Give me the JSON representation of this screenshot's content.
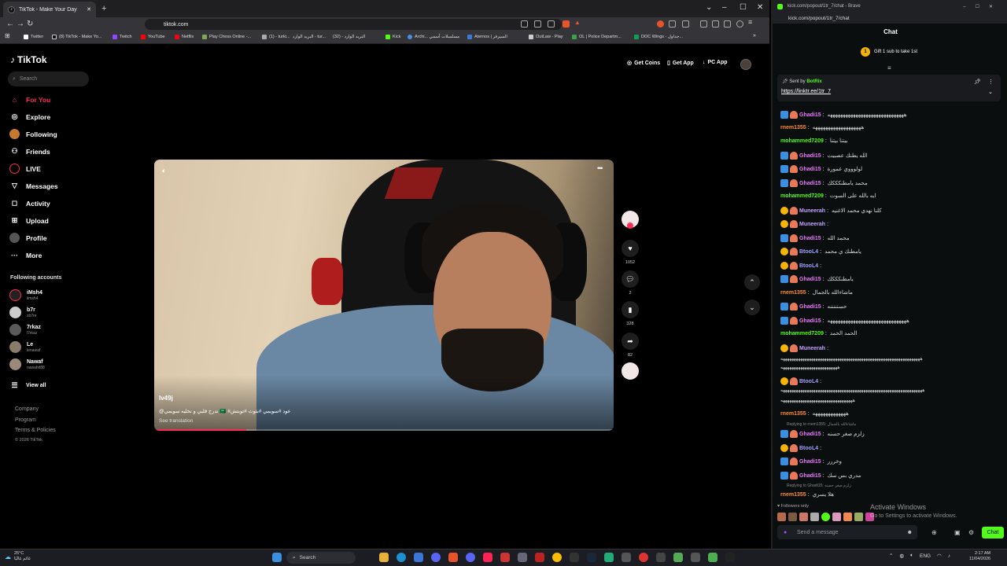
{
  "left_browser": {
    "tab_title": "TikTok - Make Your Day",
    "url": "tiktok.com",
    "bookmarks": [
      "Twitter",
      "(8) TikTok - Make Yo...",
      "Twitch",
      "YouTube",
      "Netflix",
      "Play Chess Online -...",
      "(1) - turki...",
      "البريد الوارد - tur...",
      "(32) - البريد الوارد",
      "Kick",
      "Archi... مسلسلات أسمي",
      "Aternos | السيرفر",
      "OutLaw - Play",
      "OL | Police Departm...",
      "DOC Wings - جداول..."
    ]
  },
  "tiktok": {
    "logo": "TikTok",
    "search_placeholder": "Search",
    "nav": [
      "For You",
      "Explore",
      "Following",
      "Friends",
      "LIVE",
      "Messages",
      "Activity",
      "Upload",
      "Profile",
      "More"
    ],
    "following_title": "Following accounts",
    "accounts": [
      {
        "name": "iMsh4",
        "handle": "iimsh4"
      },
      {
        "name": "b7r",
        "handle": "xb7re"
      },
      {
        "name": "7rkaz",
        "handle": "l7rkaz"
      },
      {
        "name": "Le",
        "handle": "lenawaf"
      },
      {
        "name": "Nawaf",
        "handle": "nawafxt88"
      }
    ],
    "view_all": "View all",
    "footer": [
      "Company",
      "Program",
      "Terms & Policies"
    ],
    "copyright": "© 2026 TikTok",
    "top_buttons": [
      "Get Coins",
      "Get App",
      "PC App"
    ],
    "video": {
      "author": "lv49j",
      "caption": "@ندرج قلبي و نخليه سويمي 🇸🇦 #عود #سويمي #بثوث #توبتش",
      "translate": "See translation",
      "progress": 0.2
    },
    "actions": {
      "likes": "1052",
      "comments": "2",
      "saves": "328",
      "shares": "82"
    }
  },
  "right_browser": {
    "title": "kick.com/popout/1tr_7/chat - Brave",
    "url": "kick.com/popout/1tr_7/chat",
    "chat_header": "Chat",
    "gift_text": "Gift 1 sub to take 1st",
    "gift_number": "1",
    "pinned_sent": "Sent by",
    "pinned_bot": "BotRix",
    "pinned_link": "https://linktr.ee/1tr_7",
    "messages": [
      {
        "user": "Ghadi15",
        "text": "ههههههههههههههههههههههههههههههه",
        "color": "#e879f9"
      },
      {
        "user": "rnem1355",
        "text": "هههههههههههههههههههه",
        "color": "#ff8a3d"
      },
      {
        "user": "mohammed7209",
        "text": "بيتنا بيتنا",
        "color": "#53fc18"
      },
      {
        "user": "Ghadi15",
        "text": "الله يطنك عصبيت",
        "color": "#e879f9"
      },
      {
        "user": "Ghadi15",
        "text": "لولوووي عمورة",
        "color": "#e879f9"
      },
      {
        "user": "Ghadi15",
        "text": "محمد يامطنكككك",
        "color": "#e879f9"
      },
      {
        "user": "mohammed7209",
        "text": "ايه بالله على السوت",
        "color": "#53fc18"
      },
      {
        "user": "Muneerah",
        "text": "كلنا نهدي محمد الاغنيه",
        "color": "#c4a0ff"
      },
      {
        "user": "Muneerah",
        "text": "",
        "color": "#c4a0ff"
      },
      {
        "user": "Ghadi15",
        "text": "محمد الله",
        "color": "#e879f9"
      },
      {
        "user": "BtooL4",
        "text": "يامطنك ي محمد",
        "color": "#a0a0ff"
      },
      {
        "user": "BtooL4",
        "text": "",
        "color": "#a0a0ff"
      },
      {
        "user": "Ghadi15",
        "text": "يامطنكككك",
        "color": "#e879f9"
      },
      {
        "user": "rnem1355",
        "text": "ماشاءالله بالجمال",
        "color": "#ff8a3d"
      },
      {
        "user": "Ghadi15",
        "text": "حسنننننه",
        "color": "#e879f9"
      },
      {
        "user": "Ghadi15",
        "text": "هههههههههههههههههههههههههههههههه",
        "color": "#e879f9"
      },
      {
        "user": "mohammed7209",
        "text": "الحمد الحمد",
        "color": "#53fc18"
      },
      {
        "user": "Muneerah",
        "text": "",
        "color": "#c4a0ff"
      }
    ],
    "wrap_muneerah": "ههههههههههههههههههههههههههههههههههههههههههههههههههههههههههههههههه",
    "wrap_muneerah2": "ههههههههههههههههههههههههههه",
    "msg_btool": {
      "user": "BtooL4",
      "text": ""
    },
    "wrap_btool": "هههههههههههههههههههههههههههههههههههههههههههههههههههههههههههههههههه",
    "wrap_btool2": "هههههههههههههههههههههههههههههههههه",
    "msg_rnem": {
      "user": "rnem1355",
      "text": "هههههههههههههه"
    },
    "reply1": "Replying to rnem1355: ماشاءالله بالجمال",
    "tail": [
      {
        "user": "Ghadi15",
        "text": "زلزم صغر حسنه"
      },
      {
        "user": "BtooL4",
        "text": ""
      },
      {
        "user": "Ghadi15",
        "text": "وخررر"
      },
      {
        "user": "Ghadi15",
        "text": "مدري بس سك"
      }
    ],
    "reply2": "Replying to Ghadi15: زلزم صغر حسنه",
    "last": {
      "user": "rnem1355",
      "text": "هلا يسري"
    },
    "followers_only": "Followers only",
    "input_placeholder": "Send a message",
    "chat_button": "Chat",
    "activate1": "Activate Windows",
    "activate2": "Go to Settings to activate Windows."
  },
  "taskbar": {
    "temp": "25°C",
    "weather": "غائم غالبًا",
    "search": "Search",
    "lang": "ENG",
    "time": "2:17 AM",
    "date": "11/04/2026"
  }
}
